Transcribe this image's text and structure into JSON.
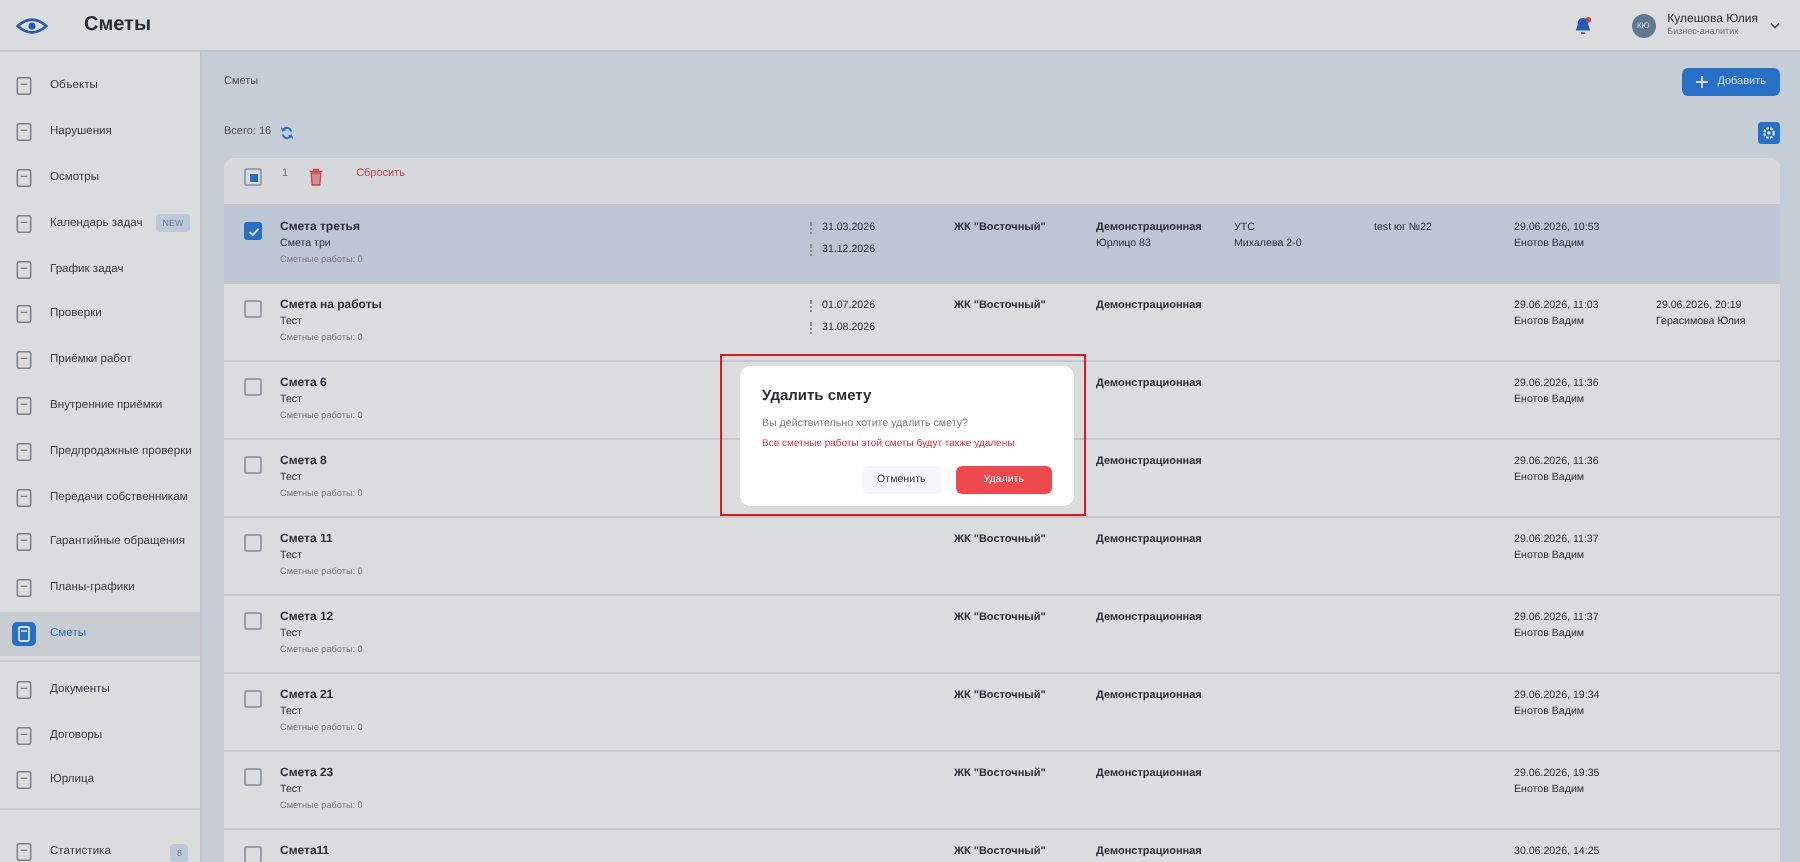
{
  "header": {
    "title": "Сметы",
    "user": {
      "initials": "КЮ",
      "name": "Кулешова Юлия",
      "role": "Бизнес-аналитик"
    }
  },
  "sidebar": {
    "sections": [
      {
        "items": [
          {
            "label": "Объекты",
            "selected": false
          },
          {
            "label": "Нарушения",
            "selected": false
          },
          {
            "label": "Осмотры",
            "selected": false
          },
          {
            "label": "Календарь задач",
            "selected": false,
            "badge": "NEW"
          },
          {
            "label": "График задач",
            "selected": false
          },
          {
            "label": "Проверки",
            "selected": false
          },
          {
            "label": "Приёмки работ",
            "selected": false
          },
          {
            "label": "Внутренние приёмки",
            "selected": false
          },
          {
            "label": "Предпродажные проверки",
            "selected": false
          },
          {
            "label": "Передачи собственникам",
            "selected": false
          },
          {
            "label": "Гарантийные обращения",
            "selected": false
          },
          {
            "label": "Планы-графики",
            "selected": false
          },
          {
            "label": "Сметы",
            "selected": true
          }
        ]
      },
      {
        "items": [
          {
            "label": "Документы",
            "selected": false
          },
          {
            "label": "Договоры",
            "selected": false
          },
          {
            "label": "Юрлица",
            "selected": false
          }
        ]
      },
      {
        "items": [
          {
            "label": "Статистика",
            "selected": false,
            "badge": "8"
          }
        ]
      }
    ]
  },
  "main": {
    "breadcrumb": "Сметы",
    "add_button": "Добавить",
    "total": "Всего: 16",
    "bulk": {
      "partial": true,
      "count": "1",
      "reset": "Сбросить"
    },
    "rows": [
      {
        "name": "Смета третья",
        "subtitle": "Смета три",
        "works": "Сметные работы: 0",
        "checked": true,
        "dates": [
          "31.03.2026",
          "31.12.2026"
        ],
        "object": "ЖК \"Восточный\"",
        "type": "Демонстрационная",
        "type_sub": "Юрлицо 83",
        "column_5": "УТС",
        "column_5_sub": "Михалева 2-0",
        "column_6": "test юг №22",
        "created": "29.06.2026, 10:53",
        "created_by": "Енотов Вадим"
      },
      {
        "name": "Смета на работы",
        "subtitle": "Тест",
        "works": "Сметные работы: 0",
        "checked": false,
        "dates": [
          "01.07.2026",
          "31.08.2026"
        ],
        "object": "ЖК \"Восточный\"",
        "type": "Демонстрационная",
        "created": "29.06.2026, 11:03",
        "created_by": "Енотов Вадим",
        "updated": "29.06.2026, 20:19",
        "updated_by": "Герасимова Юлия"
      },
      {
        "name": "Смета 6",
        "subtitle": "Тест",
        "works": "Сметные работы: 0",
        "checked": false,
        "type": "Демонстрационная",
        "created": "29.06.2026, 11:36",
        "created_by": "Енотов Вадим"
      },
      {
        "name": "Смета 8",
        "subtitle": "Тест",
        "works": "Сметные работы: 0",
        "checked": false,
        "type": "Демонстрационная",
        "created": "29.06.2026, 11:36",
        "created_by": "Енотов Вадим"
      },
      {
        "name": "Смета 11",
        "subtitle": "Тест",
        "works": "Сметные работы: 0",
        "checked": false,
        "object": "ЖК \"Восточный\"",
        "type": "Демонстрационная",
        "created": "29.06.2026, 11:37",
        "created_by": "Енотов Вадим"
      },
      {
        "name": "Смета 12",
        "subtitle": "Тест",
        "works": "Сметные работы: 0",
        "checked": false,
        "object": "ЖК \"Восточный\"",
        "type": "Демонстрационная",
        "created": "29.06.2026, 11:37",
        "created_by": "Енотов Вадим"
      },
      {
        "name": "Смета 21",
        "subtitle": "Тест",
        "works": "Сметные работы: 0",
        "checked": false,
        "object": "ЖК \"Восточный\"",
        "type": "Демонстрационная",
        "created": "29.06.2026, 19:34",
        "created_by": "Енотов Вадим"
      },
      {
        "name": "Смета 23",
        "subtitle": "Тест",
        "works": "Сметные работы: 0",
        "checked": false,
        "object": "ЖК \"Восточный\"",
        "type": "Демонстрационная",
        "created": "29.06.2026, 19:35",
        "created_by": "Енотов Вадим"
      },
      {
        "name": "Смета11",
        "checked": false,
        "object": "ЖК \"Восточный\"",
        "type": "Демонстрационная",
        "created": "30.06.2026, 14:25"
      }
    ]
  },
  "dialog": {
    "title": "Удалить смету",
    "question": "Вы действительно хотите удалить смету?",
    "warning": "Все сметные работы этой сметы будут также удалены",
    "cancel": "Отменить",
    "confirm": "Удалить"
  }
}
